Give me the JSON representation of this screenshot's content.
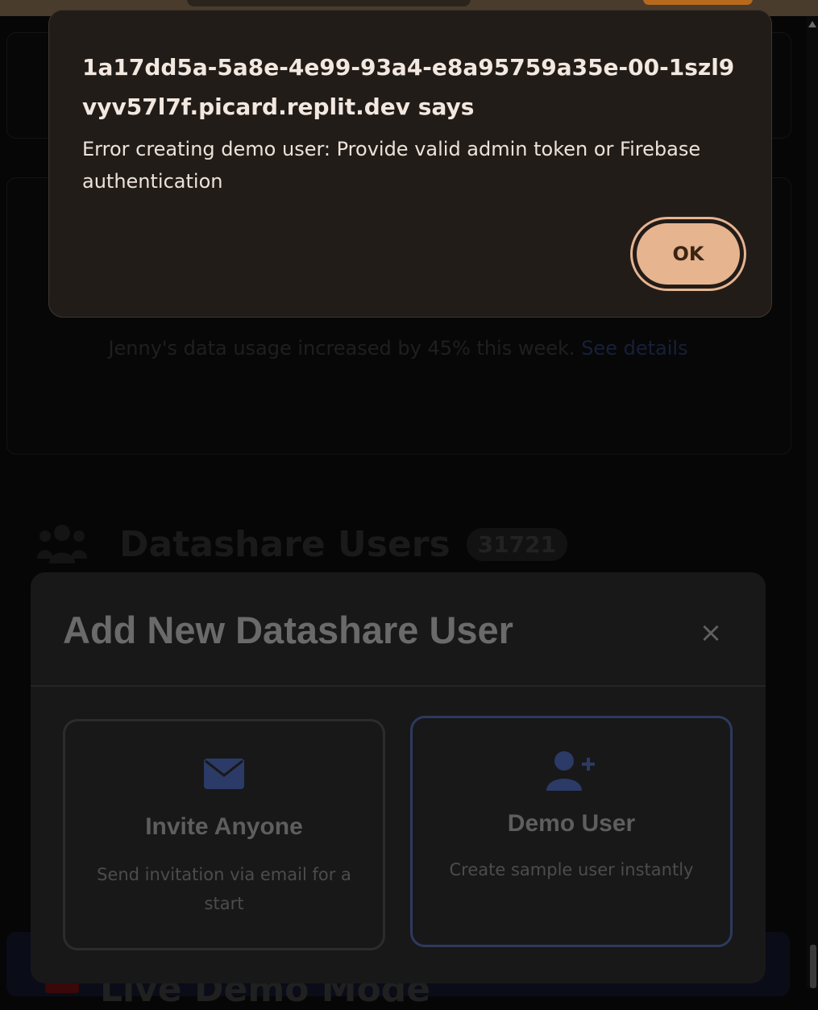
{
  "background": {
    "alert_text": "Jenny's data usage increased by 45% this week.",
    "alert_link": "See details",
    "section_title": "Datashare Users",
    "section_count": "31721",
    "bottom_card_title": "Live Demo Mode"
  },
  "modal": {
    "title": "Add New Datashare User",
    "close_symbol": "×",
    "options": [
      {
        "icon": "envelope-icon",
        "title": "Invite Anyone",
        "description": "Send invitation via email for a start"
      },
      {
        "icon": "user-plus-icon",
        "title": "Demo User",
        "description": "Create sample user instantly"
      }
    ]
  },
  "dialog": {
    "origin": "1a17dd5a-5a8e-4e99-93a4-e8a95759a35e-00-1szl9vyv57l7f.picard.replit.dev says",
    "message": "Error creating demo user: Provide valid admin token or Firebase authentication",
    "ok_label": "OK"
  },
  "colors": {
    "dialog_bg": "#221c18",
    "ok_button": "#e7b490",
    "demo_border": "#2d3a5e",
    "icon_accent": "#2b3a66"
  }
}
